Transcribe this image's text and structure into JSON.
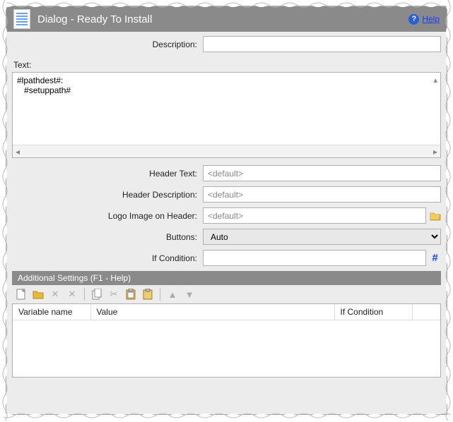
{
  "titlebar": {
    "title": "Dialog - Ready To Install",
    "help_label": "Help"
  },
  "fields": {
    "description_label": "Description:",
    "description_value": "",
    "text_label": "Text:",
    "text_value": "#lpathdest#:\n   #setuppath#",
    "header_text_label": "Header Text:",
    "header_text_placeholder": "<default>",
    "header_text_value": "",
    "header_desc_label": "Header Description:",
    "header_desc_placeholder": "<default>",
    "header_desc_value": "",
    "logo_label": "Logo Image on Header:",
    "logo_placeholder": "<default>",
    "logo_value": "",
    "buttons_label": "Buttons:",
    "buttons_value": "Auto",
    "ifcond_label": "If Condition:",
    "ifcond_value": ""
  },
  "additional": {
    "header": "Additional Settings (F1 - Help)",
    "columns": {
      "c1": "Variable name",
      "c2": "Value",
      "c3": "If Condition",
      "c4": ""
    }
  }
}
